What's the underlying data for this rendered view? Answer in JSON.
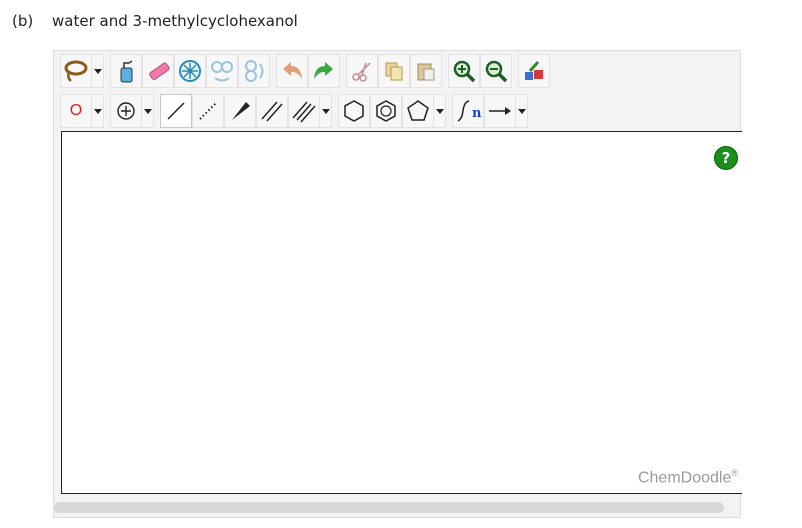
{
  "question": {
    "label": "(b)",
    "text": "water and 3-methylcyclohexanol"
  },
  "toolbar": {
    "row1": [
      "lasso-icon",
      "clear-bottle-icon",
      "eraser-icon",
      "center-icon",
      "flip-horizontal-icon",
      "flip-vertical-icon",
      "undo-icon",
      "redo-icon",
      "cut-icon",
      "copy-icon",
      "paste-icon",
      "zoom-in-icon",
      "zoom-out-icon",
      "cleanup-icon"
    ],
    "row2": [
      "element-oxygen",
      "charge-plus-icon",
      "single-bond-icon",
      "dashed-bond-icon",
      "wedge-bond-icon",
      "double-bond-icon",
      "triple-bond-icon",
      "cyclohexane-icon",
      "benzene-icon",
      "cyclopentane-icon",
      "chain-icon",
      "arrow-icon"
    ],
    "element_label": "O",
    "chain_label": "n"
  },
  "canvas": {
    "help_label": "?",
    "brand": "ChemDoodle",
    "brand_mark": "®"
  }
}
